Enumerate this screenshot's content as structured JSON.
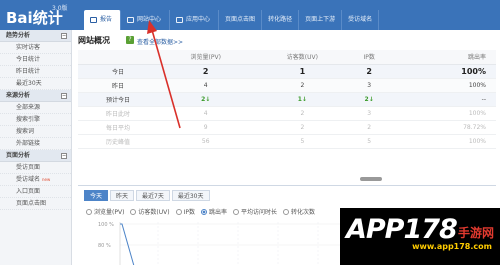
{
  "app": {
    "logo_text": "Bai统计",
    "version": "3.0版"
  },
  "nav": {
    "tabs": [
      {
        "label": "报告"
      },
      {
        "label": "网站中心"
      },
      {
        "label": "应用中心"
      }
    ],
    "subtabs": [
      {
        "label": "页面点击图"
      },
      {
        "label": "转化路径"
      },
      {
        "label": "页面上下游"
      },
      {
        "label": "受访域名"
      }
    ]
  },
  "sidebar": {
    "sections": [
      {
        "title": "趋势分析",
        "toggle": "⊟",
        "items": [
          "实时访客",
          "今日统计",
          "昨日统计",
          "最近30天"
        ]
      },
      {
        "title": "来源分析",
        "toggle": "⊟",
        "items": [
          "全部来源",
          "搜索引擎",
          "搜索词",
          "外部链接"
        ]
      },
      {
        "title": "页面分析",
        "toggle": "⊟",
        "items": [
          "受访页面",
          "受访域名",
          "入口页面",
          "页面点击图"
        ]
      }
    ],
    "new_badge": "new"
  },
  "main": {
    "title": "网站概况",
    "help_icon": "?",
    "view_all": "查看全部数据>>"
  },
  "stats": {
    "headers": [
      "",
      "浏览量(PV)",
      "访客数(UV)",
      "IP数",
      "跳出率"
    ],
    "rows": [
      {
        "label": "今日",
        "values": [
          "2",
          "1",
          "2",
          "100%"
        ],
        "style": "today"
      },
      {
        "label": "昨日",
        "values": [
          "4",
          "2",
          "3",
          "100%"
        ],
        "style": "yest"
      },
      {
        "label": "预计今日",
        "values": [
          "2↓",
          "1↓",
          "2↓",
          "--"
        ],
        "style": "forecast"
      },
      {
        "label": "昨日此时",
        "values": [
          "4",
          "2",
          "3",
          "100%"
        ],
        "style": "faded"
      },
      {
        "label": "每日平均",
        "values": [
          "9",
          "2",
          "2",
          "78.72%"
        ],
        "style": "faded"
      },
      {
        "label": "历史峰值",
        "values": [
          "56",
          "5",
          "5",
          "100%"
        ],
        "style": "faded"
      }
    ]
  },
  "chart": {
    "tabs": [
      "今天",
      "昨天",
      "最近7天",
      "最近30天"
    ],
    "active_tab": 0,
    "metrics": [
      "浏览量(PV)",
      "访客数(UV)",
      "IP数",
      "跳出率",
      "平均访问时长",
      "转化次数"
    ],
    "selected_metric": 3,
    "y_labels": [
      "100 %",
      "80 %"
    ]
  },
  "watermark": {
    "text": "APP178",
    "zh": "手游网",
    "url": "www.app178.com"
  },
  "colors": {
    "top_bar": "#3a73b9",
    "accent": "#4d84c8",
    "arrow": "#d9302a",
    "positive": "#3a9b2a"
  }
}
